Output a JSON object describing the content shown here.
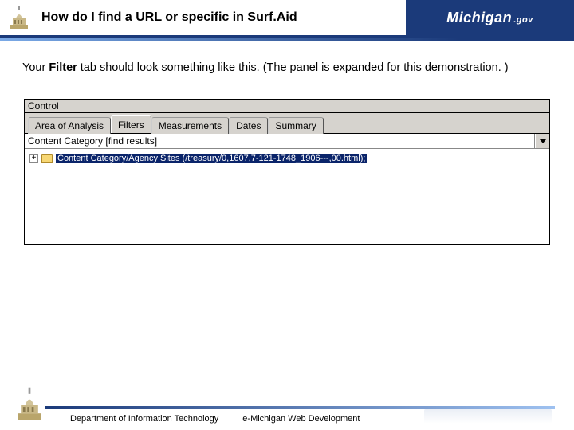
{
  "header": {
    "title": "How do I find a URL or specific in Surf.Aid",
    "brand": "Michigan",
    "brand_suffix": ".gov"
  },
  "content": {
    "intro_pre": "Your ",
    "intro_bold": "Filter",
    "intro_post": " tab should look something like this. (The panel is expanded for this demonstration. )"
  },
  "panel": {
    "title": "Control",
    "tabs": [
      {
        "label": "Area of Analysis"
      },
      {
        "label": "Filters"
      },
      {
        "label": "Measurements"
      },
      {
        "label": "Dates"
      },
      {
        "label": "Summary"
      }
    ],
    "dropdown_value": "Content Category [find results]",
    "expander": "+",
    "tree_item": "Content Category/Agency Sites (/treasury/0,1607,7-121-1748_1906---,00.html);"
  },
  "footer": {
    "left": "Department of Information Technology",
    "mid": "e-Michigan Web Development"
  }
}
